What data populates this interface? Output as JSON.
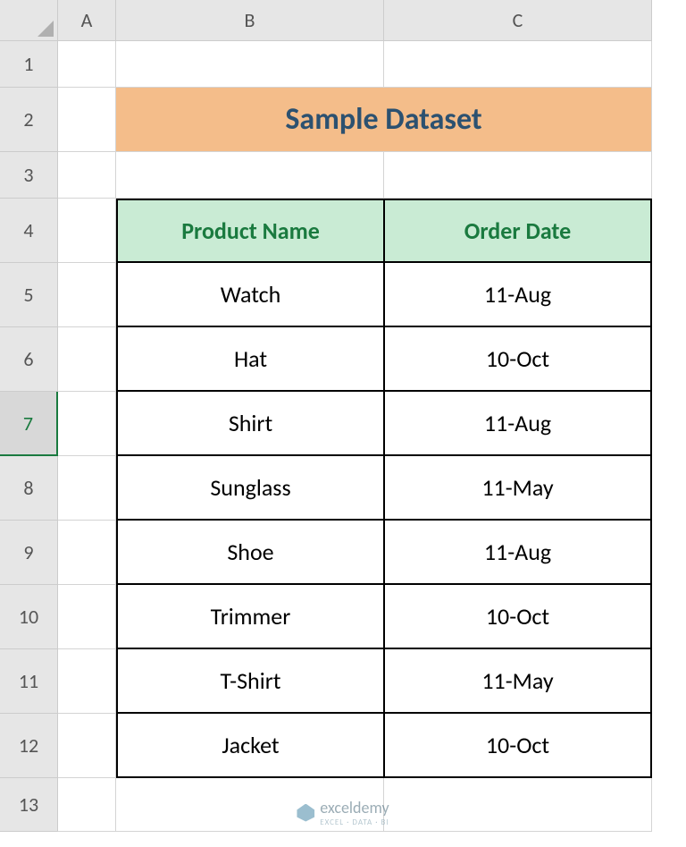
{
  "columns": [
    "A",
    "B",
    "C"
  ],
  "rows": [
    "1",
    "2",
    "3",
    "4",
    "5",
    "6",
    "7",
    "8",
    "9",
    "10",
    "11",
    "12",
    "13"
  ],
  "selected_row_index": 6,
  "title": "Sample Dataset",
  "headers": {
    "product": "Product Name",
    "date": "Order Date"
  },
  "data": [
    {
      "product": "Watch",
      "date": "11-Aug"
    },
    {
      "product": "Hat",
      "date": "10-Oct"
    },
    {
      "product": "Shirt",
      "date": "11-Aug"
    },
    {
      "product": "Sunglass",
      "date": "11-May"
    },
    {
      "product": "Shoe",
      "date": "11-Aug"
    },
    {
      "product": "Trimmer",
      "date": "10-Oct"
    },
    {
      "product": "T-Shirt",
      "date": "11-May"
    },
    {
      "product": "Jacket",
      "date": "10-Oct"
    }
  ],
  "watermark": {
    "brand": "exceldemy",
    "tagline": "EXCEL · DATA · BI"
  }
}
